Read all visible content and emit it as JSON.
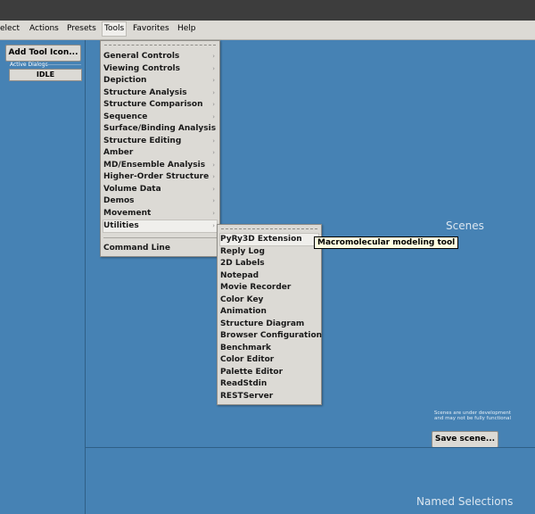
{
  "menubar": {
    "items": [
      {
        "label": "elect",
        "underline": ""
      },
      {
        "label": "Actions"
      },
      {
        "label": "Presets"
      },
      {
        "label": "Tools"
      },
      {
        "label": "Favorites"
      },
      {
        "label": "Help"
      }
    ]
  },
  "left_panel": {
    "add_tool_label": "Add Tool Icon...",
    "active_dialogs_label": "Active Dialogs",
    "idle_label": "IDLE"
  },
  "tools_menu": {
    "items": [
      "General Controls",
      "Viewing Controls",
      "Depiction",
      "Structure Analysis",
      "Structure Comparison",
      "Sequence",
      "Surface/Binding Analysis",
      "Structure Editing",
      "Amber",
      "MD/Ensemble Analysis",
      "Higher-Order Structure",
      "Volume Data",
      "Demos",
      "Movement",
      "Utilities"
    ],
    "command_line_label": "Command Line"
  },
  "utilities_menu": {
    "items": [
      "PyRy3D Extension",
      "Reply Log",
      "2D Labels",
      "Notepad",
      "Movie Recorder",
      "Color Key",
      "Animation",
      "Structure Diagram",
      "Browser Configuration",
      "Benchmark",
      "Color Editor",
      "Palette Editor",
      "ReadStdin",
      "RESTServer"
    ]
  },
  "tooltip": {
    "text": "Macromolecular modeling tool"
  },
  "scenes": {
    "title": "Scenes",
    "note": "Scenes are under development and may not be fully functional",
    "save_label": "Save scene..."
  },
  "named_selections": {
    "title": "Named Selections"
  },
  "icons": {
    "submenu_arrow": "chevron-right-icon"
  },
  "colors": {
    "background": "#4682b4",
    "menu": "#dcdad5",
    "tooltip": "#ffffe1"
  }
}
